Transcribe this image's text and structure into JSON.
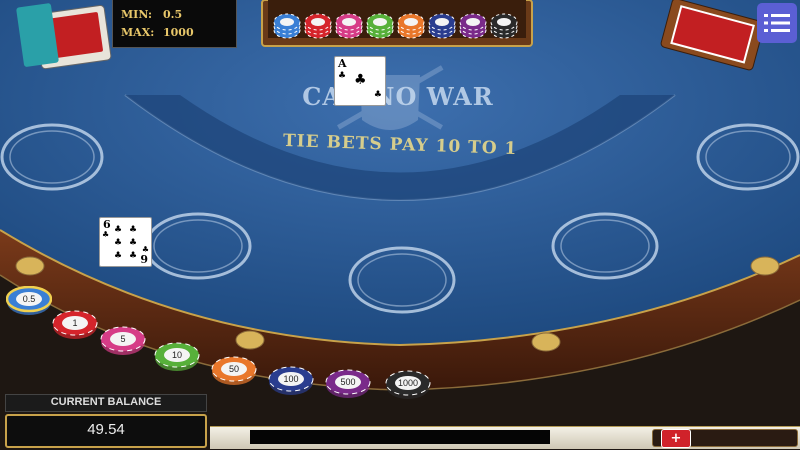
{
  "game": {
    "table_title": "CASINO WAR",
    "table_subtitle": "TIE BETS PAY 10 TO 1"
  },
  "limits": {
    "min_label": "MIN:",
    "min_value": "0.5",
    "max_label": "MAX:",
    "max_value": "1000"
  },
  "dealer_card": {
    "rank": "A",
    "suit": "♣"
  },
  "player_card": {
    "rank": "6",
    "rank_bottom": "9",
    "suit": "♣"
  },
  "chips": [
    {
      "value": "0.5",
      "color": "#3a7fd5"
    },
    {
      "value": "1",
      "color": "#d5242b"
    },
    {
      "value": "5",
      "color": "#d63c87"
    },
    {
      "value": "10",
      "color": "#57b03a"
    },
    {
      "value": "50",
      "color": "#e9772b"
    },
    {
      "value": "100",
      "color": "#2a3d8f"
    },
    {
      "value": "500",
      "color": "#7a2a8a"
    },
    {
      "value": "1000",
      "color": "#2a2a2a"
    }
  ],
  "balance": {
    "label": "CURRENT BALANCE",
    "value": "49.54"
  },
  "volume": {
    "button_label": "+"
  },
  "colors": {
    "felt": "#2a5a93",
    "rail": "#5a2a12",
    "gold": "#c8a24a",
    "menu": "#5b5fd4"
  }
}
